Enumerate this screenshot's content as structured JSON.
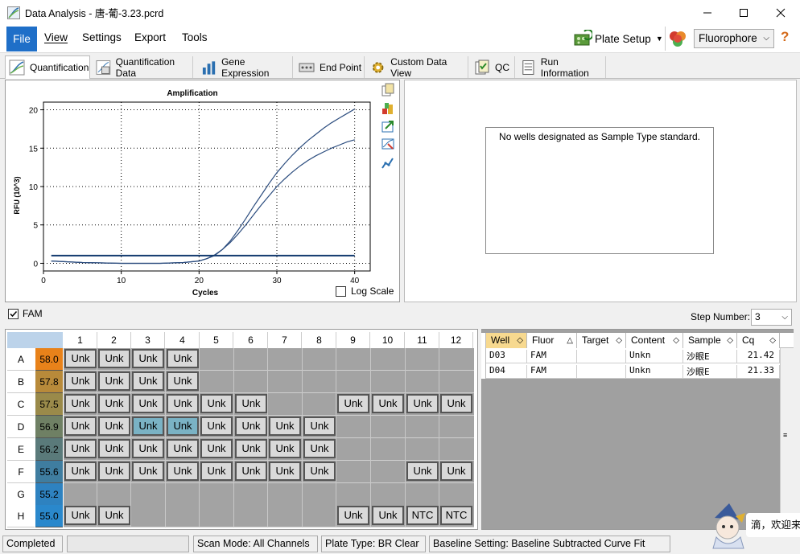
{
  "window": {
    "title": "Data Analysis - 唐-葡-3.23.pcrd"
  },
  "menu": {
    "file": "File",
    "view": "View",
    "settings": "Settings",
    "export": "Export",
    "tools": "Tools"
  },
  "toolbar": {
    "plate_setup": "Plate Setup",
    "fluorophore": "Fluorophore"
  },
  "tabs": [
    "Quantification",
    "Quantification Data",
    "Gene Expression",
    "End Point",
    "Custom Data View",
    "QC",
    "Run Information"
  ],
  "chart_data": {
    "type": "line",
    "title": "Amplification",
    "xlabel": "Cycles",
    "ylabel": "RFU (10^3)",
    "xlim": [
      0,
      42
    ],
    "ylim": [
      -1,
      21
    ],
    "xticks": [
      0,
      10,
      20,
      30,
      40
    ],
    "yticks": [
      0,
      5,
      10,
      15,
      20
    ],
    "grid": true,
    "series": [
      {
        "x": [
          1,
          5,
          10,
          15,
          18,
          20,
          21,
          22,
          23,
          24,
          25,
          26,
          27,
          28,
          29,
          30,
          31,
          32,
          33,
          34,
          35,
          36,
          37,
          38,
          39,
          40
        ],
        "values": [
          0.3,
          0.1,
          0.0,
          0.0,
          0.1,
          0.3,
          0.6,
          1.1,
          1.8,
          2.7,
          3.8,
          5.0,
          6.3,
          7.6,
          8.8,
          10.0,
          11.0,
          11.9,
          12.7,
          13.4,
          14.0,
          14.5,
          15.0,
          15.4,
          15.8,
          16.1
        ]
      },
      {
        "x": [
          1,
          5,
          10,
          15,
          18,
          20,
          21,
          22,
          23,
          24,
          25,
          26,
          27,
          28,
          29,
          30,
          31,
          32,
          33,
          34,
          35,
          36,
          37,
          38,
          39,
          40
        ],
        "values": [
          0.3,
          0.1,
          0.0,
          0.0,
          0.1,
          0.3,
          0.6,
          1.0,
          1.8,
          2.9,
          4.3,
          5.8,
          7.4,
          8.9,
          10.4,
          11.8,
          13.0,
          14.1,
          15.1,
          16.0,
          16.8,
          17.6,
          18.3,
          18.9,
          19.5,
          20.1
        ]
      },
      {
        "x": [
          1,
          40
        ],
        "values": [
          1.0,
          1.0
        ]
      }
    ]
  },
  "log_scale_label": "Log Scale",
  "standard_msg": "No wells designated as Sample Type standard.",
  "fam_label": "FAM",
  "step_number": {
    "label": "Step Number:",
    "value": "3"
  },
  "plate": {
    "columns": [
      "1",
      "2",
      "3",
      "4",
      "5",
      "6",
      "7",
      "8",
      "9",
      "10",
      "11",
      "12"
    ],
    "rows": [
      {
        "row": "A",
        "temp": "58.0",
        "wells": [
          "Unk",
          "Unk",
          "Unk",
          "Unk",
          "",
          "",
          "",
          "",
          "",
          "",
          "",
          ""
        ]
      },
      {
        "row": "B",
        "temp": "57.8",
        "wells": [
          "Unk",
          "Unk",
          "Unk",
          "Unk",
          "",
          "",
          "",
          "",
          "",
          "",
          "",
          ""
        ]
      },
      {
        "row": "C",
        "temp": "57.5",
        "wells": [
          "Unk",
          "Unk",
          "Unk",
          "Unk",
          "Unk",
          "Unk",
          "",
          "",
          "Unk",
          "Unk",
          "Unk",
          "Unk"
        ]
      },
      {
        "row": "D",
        "temp": "56.9",
        "wells": [
          "Unk",
          "Unk",
          "Unk",
          "Unk",
          "Unk",
          "Unk",
          "Unk",
          "Unk",
          "",
          "",
          "",
          ""
        ]
      },
      {
        "row": "E",
        "temp": "56.2",
        "wells": [
          "Unk",
          "Unk",
          "Unk",
          "Unk",
          "Unk",
          "Unk",
          "Unk",
          "Unk",
          "",
          "",
          "",
          ""
        ]
      },
      {
        "row": "F",
        "temp": "55.6",
        "wells": [
          "Unk",
          "Unk",
          "Unk",
          "Unk",
          "Unk",
          "Unk",
          "Unk",
          "Unk",
          "",
          "",
          "Unk",
          "Unk"
        ]
      },
      {
        "row": "G",
        "temp": "55.2",
        "wells": [
          "",
          "",
          "",
          "",
          "",
          "",
          "",
          "",
          "",
          "",
          "",
          ""
        ]
      },
      {
        "row": "H",
        "temp": "55.0",
        "wells": [
          "Unk",
          "Unk",
          "",
          "",
          "",
          "",
          "",
          "",
          "Unk",
          "Unk",
          "NTC",
          "NTC"
        ]
      }
    ],
    "selected": [
      "D3",
      "D4"
    ]
  },
  "table": {
    "headers": [
      "Well",
      "Fluor",
      "Target",
      "Content",
      "Sample",
      "Cq"
    ],
    "rows": [
      [
        "D03",
        "FAM",
        "",
        "Unkn",
        "沙眼E",
        "21.42"
      ],
      [
        "D04",
        "FAM",
        "",
        "Unkn",
        "沙眼E",
        "21.33"
      ]
    ]
  },
  "status": {
    "state": "Completed",
    "scan_mode": "Scan Mode: All Channels",
    "plate_type": "Plate Type: BR Clear",
    "baseline": "Baseline Setting: Baseline Subtracted Curve Fit"
  },
  "overlay": {
    "welcome": "滴，欢迎来"
  },
  "colors": {
    "accent": "#1f6fc8",
    "selected_well": "#7ab2c4",
    "curve": "#2b4c7e",
    "threshold": "#123a6e"
  }
}
